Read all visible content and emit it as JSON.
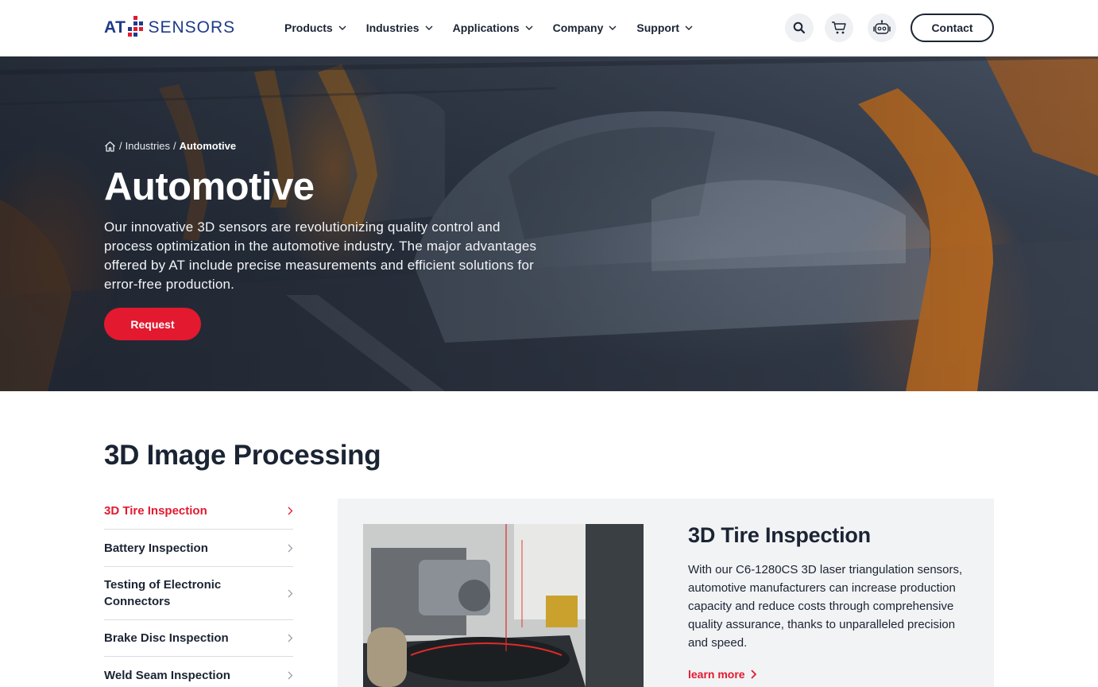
{
  "header": {
    "logo": {
      "left": "AT",
      "right": "SENSORS"
    },
    "nav": [
      {
        "label": "Products"
      },
      {
        "label": "Industries"
      },
      {
        "label": "Applications"
      },
      {
        "label": "Company"
      },
      {
        "label": "Support"
      }
    ],
    "icons": [
      "search-icon",
      "cart-icon",
      "chatbot-icon"
    ],
    "contact_label": "Contact"
  },
  "hero": {
    "breadcrumb": {
      "home_icon": "home-icon",
      "sep": "/",
      "parent": "Industries",
      "current": "Automotive"
    },
    "title": "Automotive",
    "text": "Our innovative 3D sensors are revolutionizing quality control and process optimization in the automotive industry. The major advantages offered by AT include precise measurements and efficient solutions for error-free production.",
    "button_label": "Request"
  },
  "section": {
    "title": "3D Image Processing",
    "items": [
      {
        "label": "3D Tire Inspection",
        "active": true
      },
      {
        "label": "Battery Inspection"
      },
      {
        "label": "Testing of Electronic Connectors"
      },
      {
        "label": "Brake Disc Inspection"
      },
      {
        "label": "Weld Seam Inspection"
      }
    ],
    "panel": {
      "title": "3D Tire Inspection",
      "text": "With our C6-1280CS 3D laser triangulation sensors, automotive manufacturers can increase production capacity and reduce costs through comprehensive quality assurance, thanks to unparalleled precision and speed.",
      "link_label": "learn more"
    }
  },
  "colors": {
    "accent": "#e3192f",
    "brand": "#1e3a8a",
    "text": "#1b2433",
    "panel_bg": "#f2f3f5"
  }
}
